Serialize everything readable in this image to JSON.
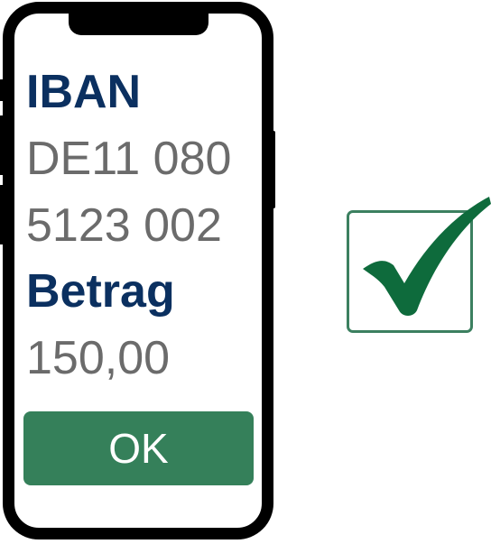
{
  "screen": {
    "iban_label": "IBAN",
    "iban_line1": "DE11 080",
    "iban_line2": "5123 002",
    "amount_label": "Betrag",
    "amount_value": "150,00",
    "ok_label": "OK"
  },
  "icons": {
    "phone": "smartphone-outline-icon",
    "confirm": "checkbox-checked-icon"
  },
  "colors": {
    "label": "#0b3060",
    "value": "#6b6b6b",
    "ok_button": "#35805a",
    "check": "#0e6b3c",
    "check_border": "#3c8060"
  }
}
